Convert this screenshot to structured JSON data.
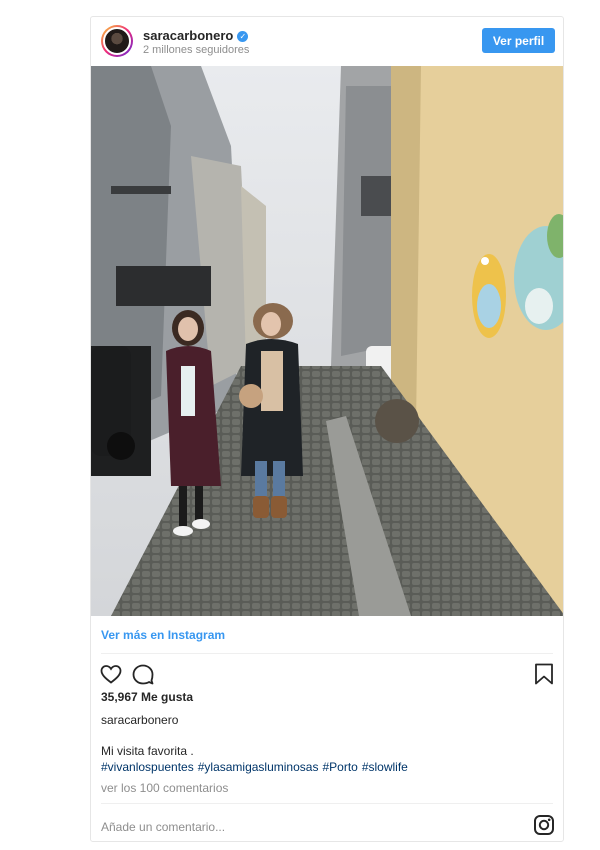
{
  "header": {
    "username": "saracarbonero",
    "followers": "2 millones seguidores",
    "view_profile_label": "Ver perfil"
  },
  "post": {
    "view_more_label": "Ver más en Instagram",
    "likes": "35,967 Me gusta",
    "caption_user": "saracarbonero",
    "caption_text": "Mi visita favorita .",
    "hashtags": [
      "#vivanlospuentes",
      "#ylasamigasluminosas",
      "#Porto",
      "#slowlife"
    ],
    "comments_link": "ver los 100 comentarios",
    "comment_placeholder": "Añade un comentario..."
  },
  "icons": {
    "like": "heart-icon",
    "comment": "comment-bubble-icon",
    "save": "bookmark-icon",
    "instagram": "instagram-logo-icon",
    "verified": "verified-badge-icon"
  },
  "colors": {
    "accent": "#3897f0",
    "hashtag": "#003569",
    "muted": "#8e8e8e"
  }
}
